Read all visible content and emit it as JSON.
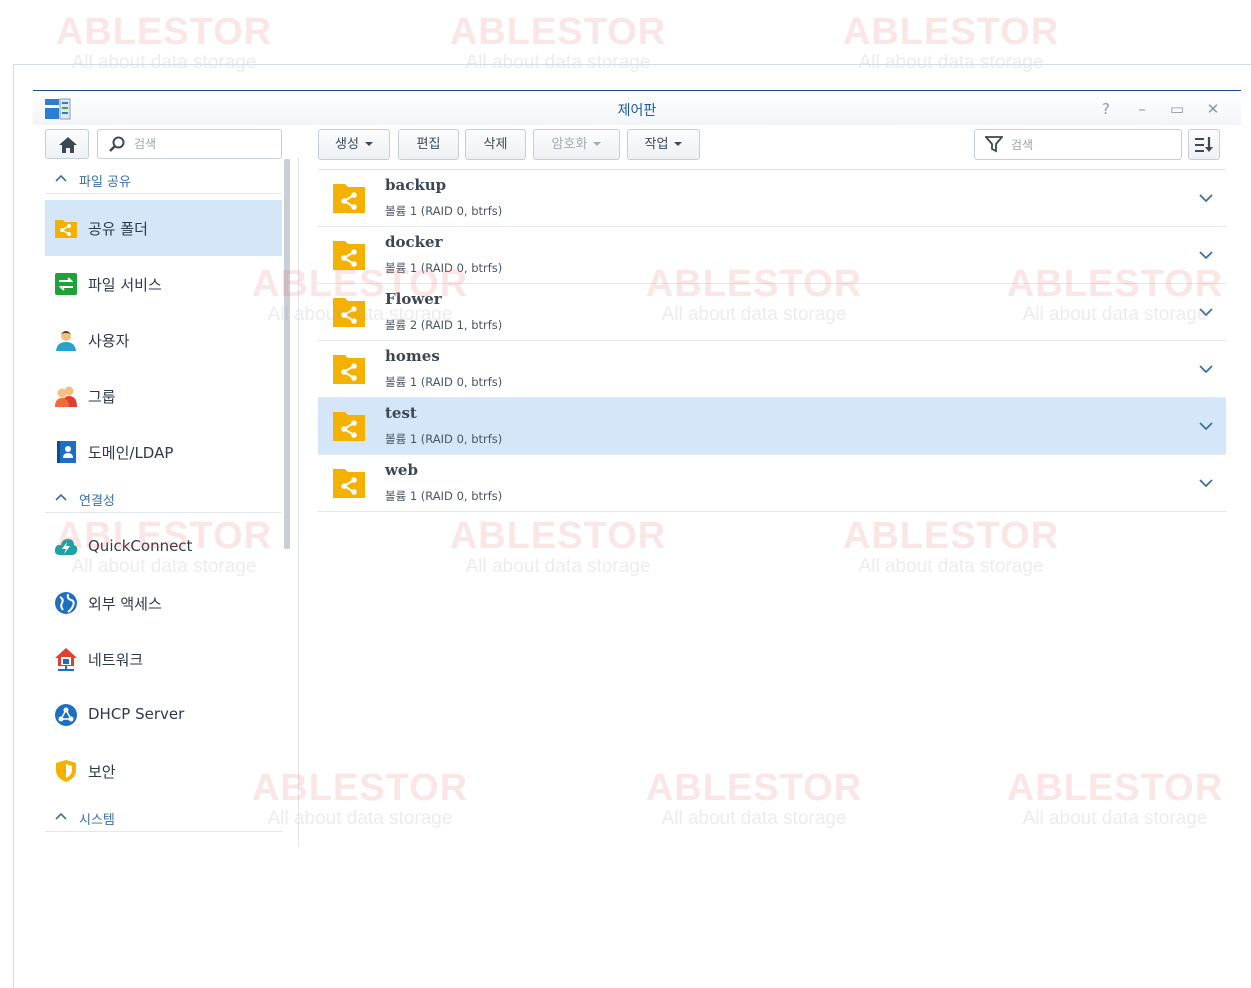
{
  "watermark": {
    "brand": "ABLESTOR",
    "tagline": "All about data storage"
  },
  "window": {
    "title": "제어판",
    "help_label": "?",
    "minimize_label": "–",
    "maximize_label": "▭",
    "close_label": "✕"
  },
  "sidebar": {
    "search_placeholder": "검색",
    "sections": [
      {
        "label": "파일 공유",
        "items": [
          {
            "label": "공유 폴더",
            "icon": "shared-folder-icon",
            "active": true
          },
          {
            "label": "파일 서비스",
            "icon": "file-services-icon"
          },
          {
            "label": "사용자",
            "icon": "user-icon"
          },
          {
            "label": "그룹",
            "icon": "group-icon"
          },
          {
            "label": "도메인/LDAP",
            "icon": "domain-ldap-icon"
          }
        ]
      },
      {
        "label": "연결성",
        "items": [
          {
            "label": "QuickConnect",
            "icon": "quickconnect-icon"
          },
          {
            "label": "외부 액세스",
            "icon": "external-access-icon"
          },
          {
            "label": "네트워크",
            "icon": "network-icon"
          },
          {
            "label": "DHCP Server",
            "icon": "dhcp-server-icon"
          },
          {
            "label": "보안",
            "icon": "security-shield-icon"
          }
        ]
      },
      {
        "label": "시스템",
        "items": []
      }
    ]
  },
  "toolbar": {
    "create_label": "생성",
    "edit_label": "편집",
    "delete_label": "삭제",
    "encrypt_label": "암호화",
    "action_label": "작업",
    "filter_placeholder": "검색"
  },
  "folders": [
    {
      "name": "backup",
      "detail": "볼륨 1 (RAID 0, btrfs)"
    },
    {
      "name": "docker",
      "detail": "볼륨 1 (RAID 0, btrfs)"
    },
    {
      "name": "Flower",
      "detail": "볼륨 2 (RAID 1, btrfs)"
    },
    {
      "name": "homes",
      "detail": "볼륨 1 (RAID 0, btrfs)"
    },
    {
      "name": "test",
      "detail": "볼륨 1 (RAID 0, btrfs)",
      "selected": true
    },
    {
      "name": "web",
      "detail": "볼륨 1 (RAID 0, btrfs)"
    }
  ],
  "colors": {
    "accent": "#1c5b9e",
    "selection": "#d5e6f8",
    "folder": "#f5b100"
  }
}
